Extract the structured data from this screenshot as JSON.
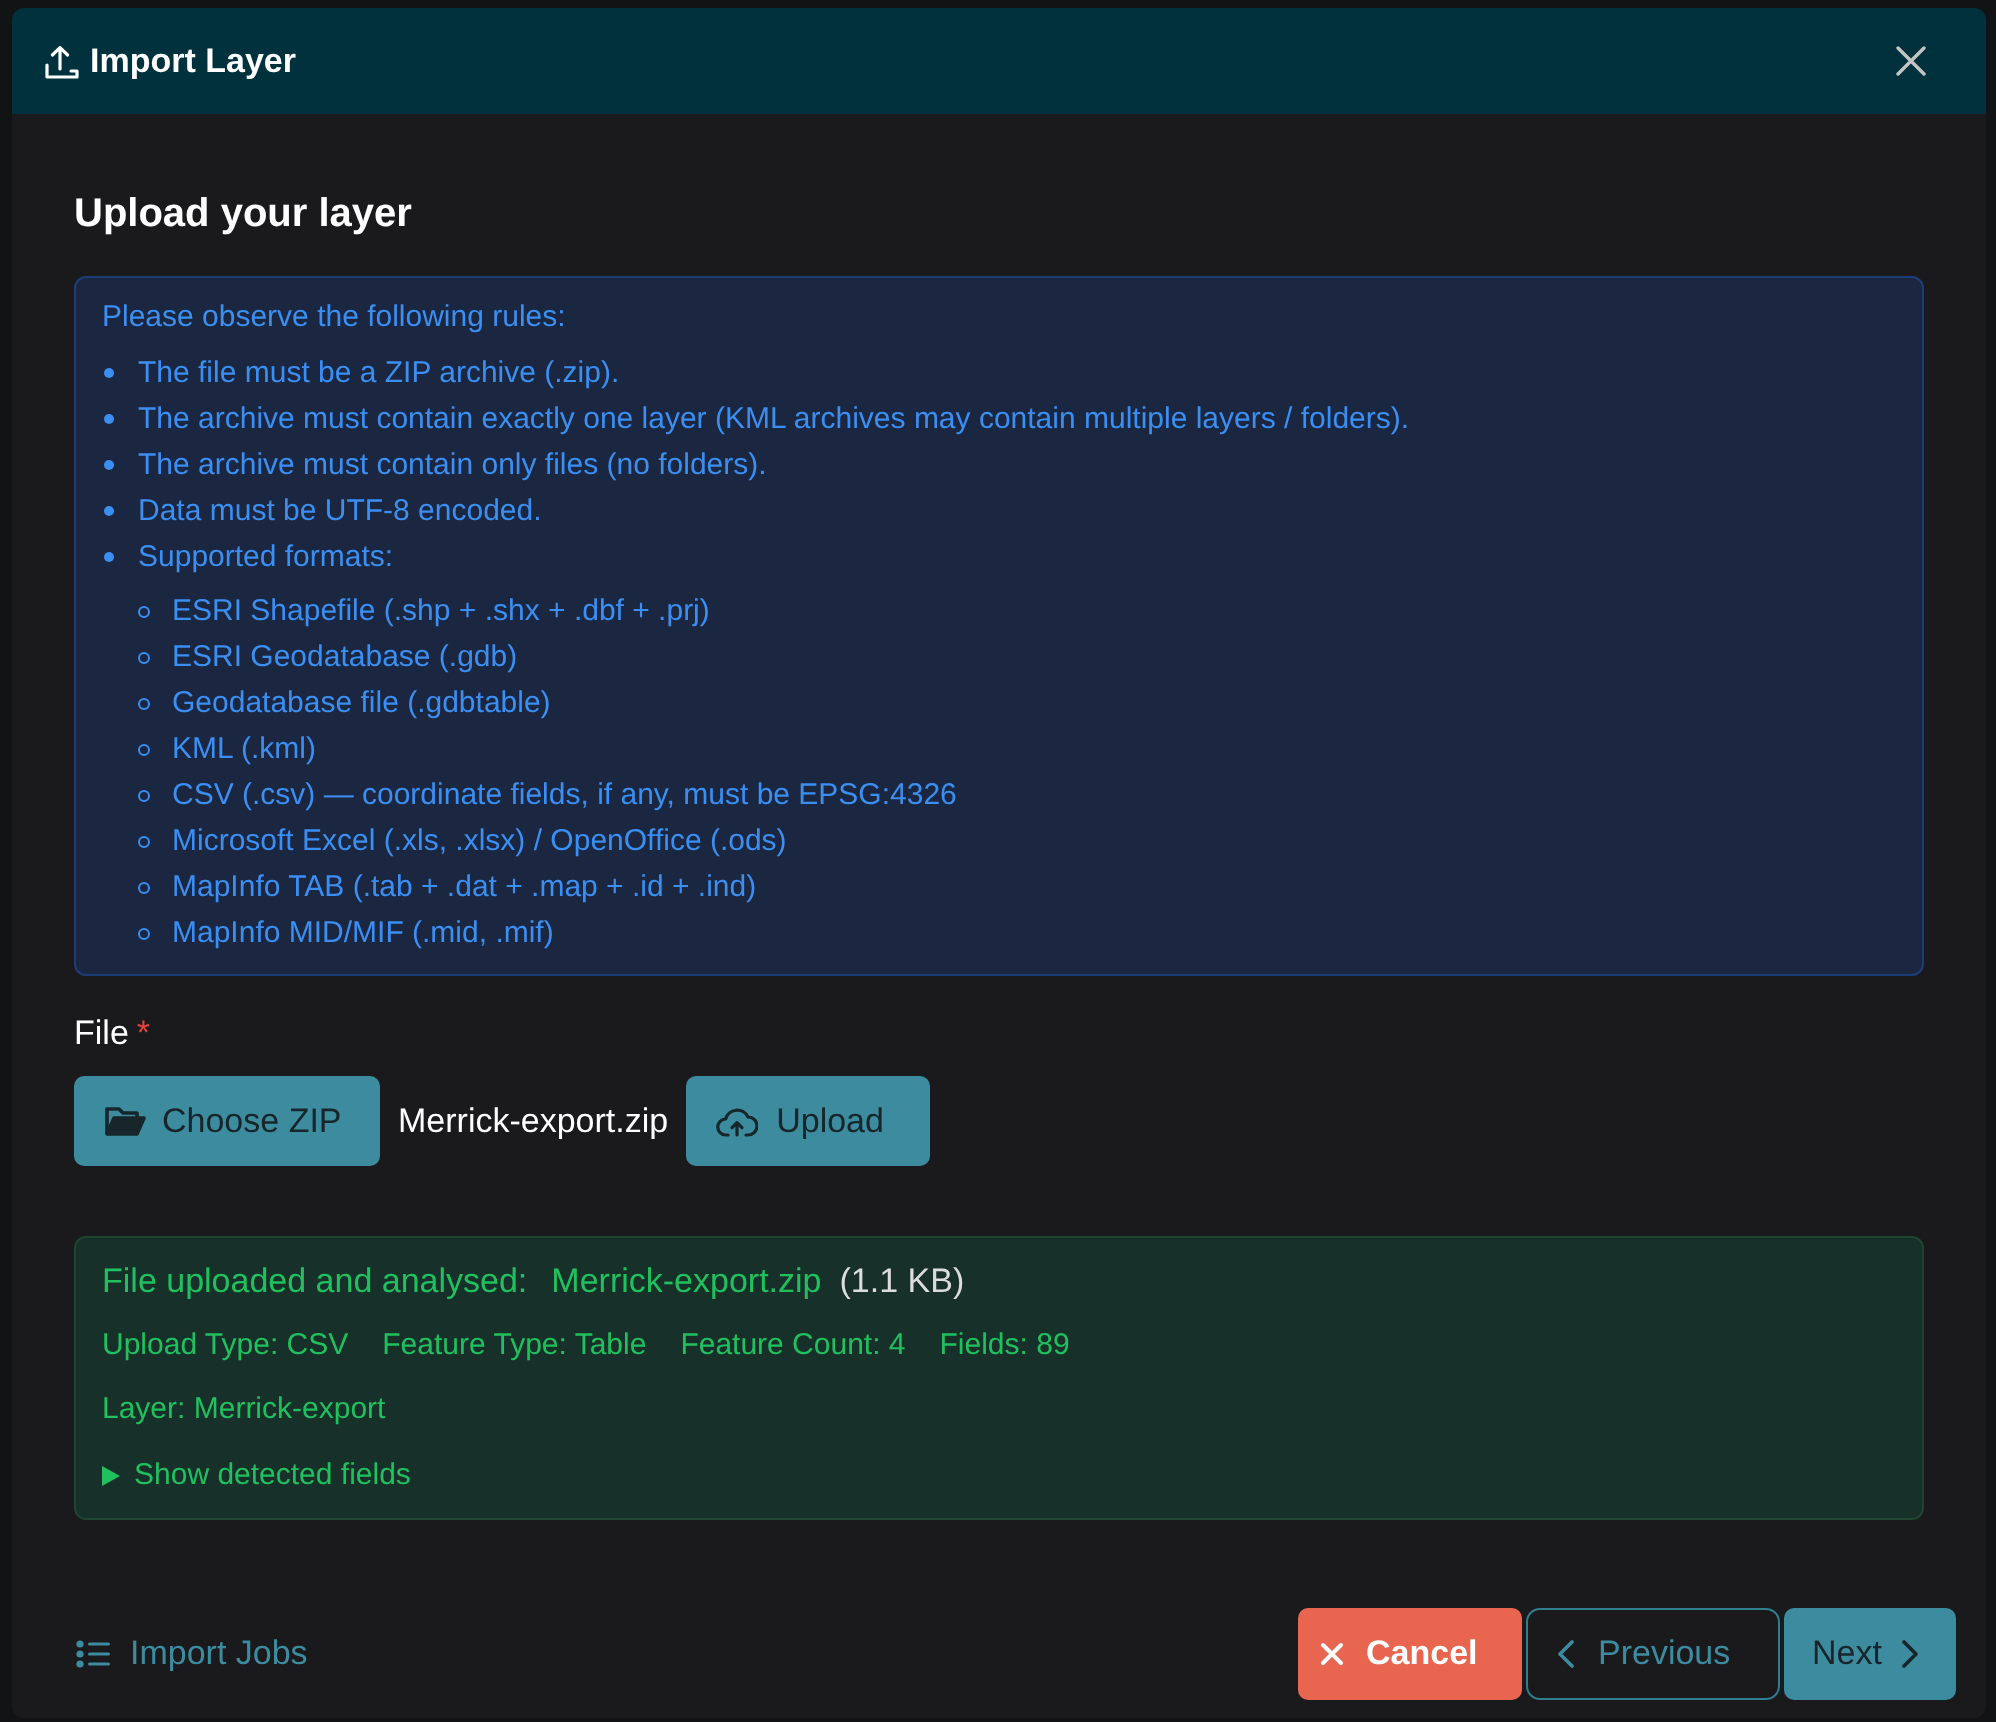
{
  "window": {
    "title": "Import Layer"
  },
  "heading": "Upload your layer",
  "rules": {
    "intro": "Please observe the following rules:",
    "items": [
      {
        "text": "The file must be a ZIP archive (.zip)."
      },
      {
        "text": "The archive must contain exactly one layer (KML archives may contain multiple layers / folders)."
      },
      {
        "text": "The archive must contain only files (no folders)."
      },
      {
        "text": "Data must be UTF-8 encoded."
      },
      {
        "text": "Supported formats:",
        "children": [
          {
            "text": "ESRI Shapefile (.shp + .shx + .dbf + .prj)"
          },
          {
            "text": "ESRI Geodatabase (.gdb)"
          },
          {
            "text": "Geodatabase file (.gdbtable)"
          },
          {
            "text": "KML (.kml)"
          },
          {
            "text": "CSV (.csv) — coordinate fields, if any, must be EPSG:4326"
          },
          {
            "text": "Microsoft Excel (.xls, .xlsx) / OpenOffice (.ods)"
          },
          {
            "text": "MapInfo TAB (.tab + .dat + .map + .id + .ind)"
          },
          {
            "text": "MapInfo MID/MIF (.mid, .mif)"
          }
        ]
      }
    ]
  },
  "file_field": {
    "label": "File",
    "required_mark": "*",
    "choose_button": "Choose ZIP",
    "file_name": "Merrick-export.zip",
    "upload_button": "Upload"
  },
  "upload_result": {
    "title": "File uploaded and analysed:",
    "file_name": "Merrick-export.zip",
    "size": "(1.1 KB)",
    "details": [
      "Upload Type: CSV",
      "Feature Type: Table",
      "Feature Count: 4",
      "Fields: 89"
    ],
    "layer": "Layer: Merrick-export",
    "toggle": {
      "label": "Show detected fields",
      "expanded": false
    }
  },
  "footer": {
    "link": "Import Jobs",
    "buttons": [
      {
        "label": "Cancel",
        "kind": "cancel"
      },
      {
        "label": "Previous",
        "kind": "previous"
      },
      {
        "label": "Next",
        "kind": "next"
      }
    ]
  }
}
